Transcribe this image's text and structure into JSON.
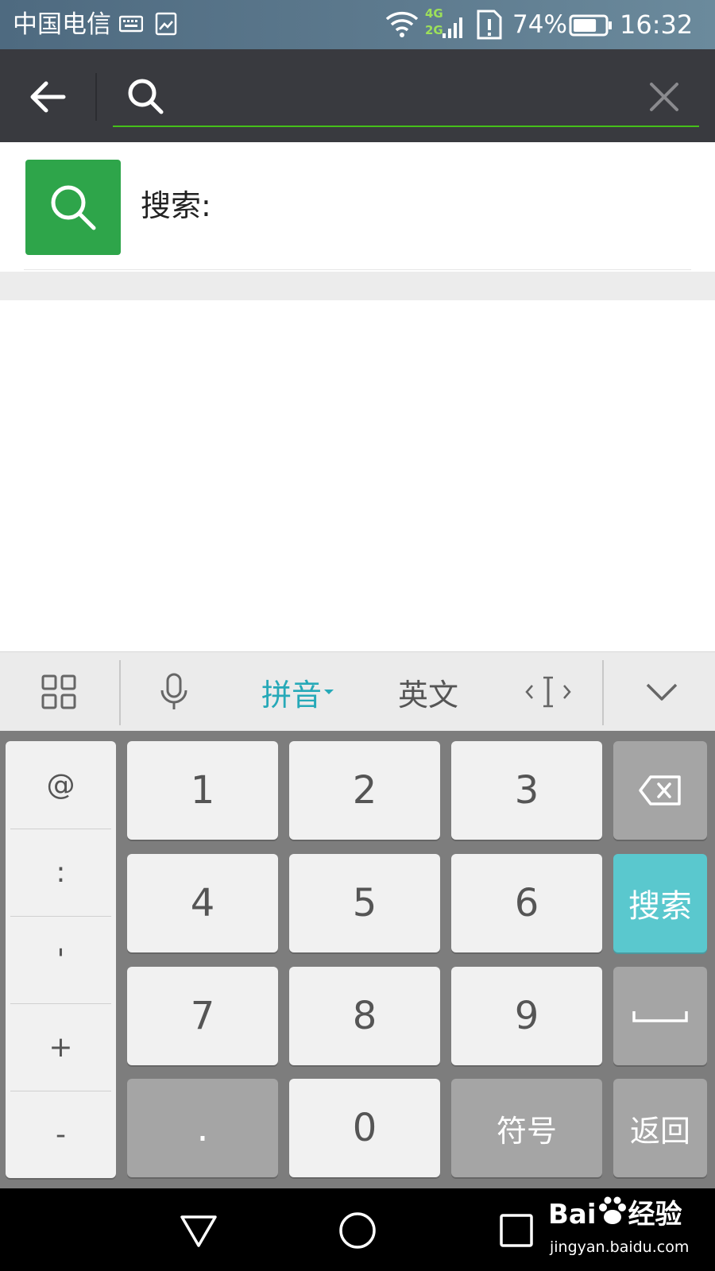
{
  "status_bar": {
    "carrier": "中国电信",
    "network_top": "4G",
    "network_bottom": "2G",
    "battery_percent": "74%",
    "battery_level": 0.74,
    "time": "16:32"
  },
  "search": {
    "query": "",
    "placeholder": "",
    "accent_color": "#45c01a"
  },
  "suggestion": {
    "label": "搜索:",
    "icon_color": "#2ea54a"
  },
  "keyboard": {
    "toolbar": {
      "pinyin_label": "拼音",
      "english_label": "英文",
      "pinyin_color": "#26a9b8"
    },
    "symbols": [
      "@",
      ":",
      "'",
      "+",
      "-"
    ],
    "digits": [
      "1",
      "2",
      "3",
      "4",
      "5",
      "6",
      "7",
      "8",
      "9"
    ],
    "dot": ".",
    "zero": "0",
    "symbol_key": "符号",
    "search_key": "搜索",
    "return_key": "返回",
    "accent_color": "#5ac8ce"
  },
  "watermark": {
    "brand": "Bai",
    "brand_suffix": "经验",
    "url": "jingyan.baidu.com"
  }
}
